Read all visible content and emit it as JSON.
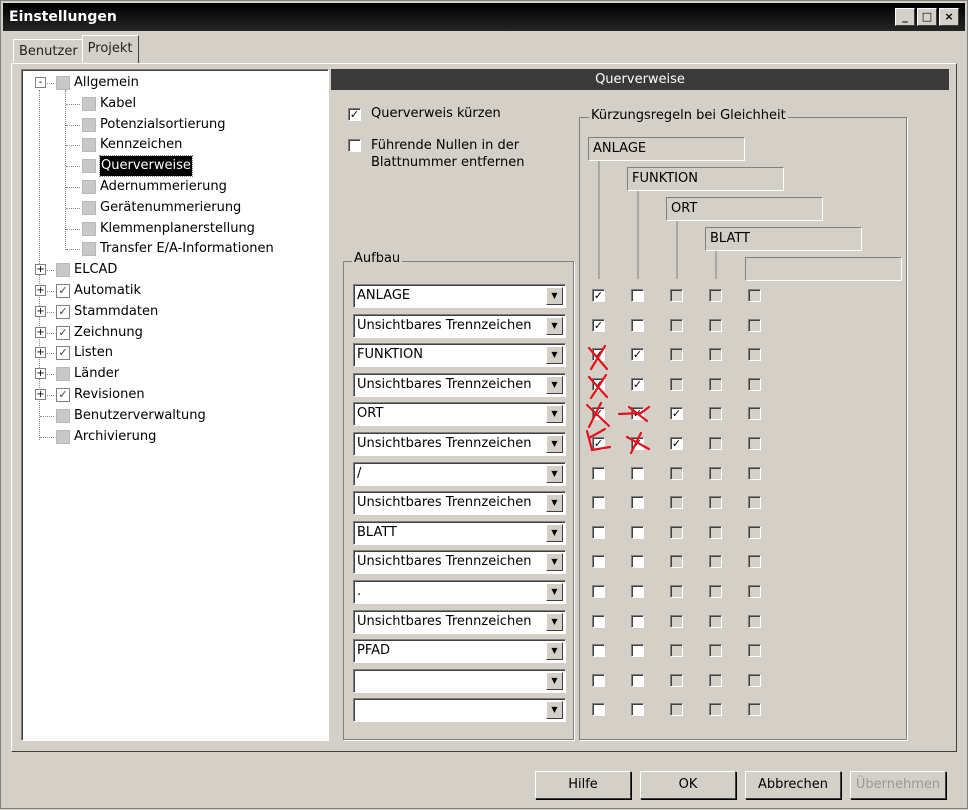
{
  "window": {
    "title": "Einstellungen",
    "min": "_",
    "max": "□",
    "close": "×"
  },
  "tabs": [
    {
      "label": "Benutzer"
    },
    {
      "label": "Projekt"
    }
  ],
  "tree": {
    "items": [
      {
        "label": "Allgemein"
      },
      {
        "label": "Kabel"
      },
      {
        "label": "Potenzialsortierung"
      },
      {
        "label": "Kennzeichen"
      },
      {
        "label": "Querverweise"
      },
      {
        "label": "Adernummerierung"
      },
      {
        "label": "Gerätenummerierung"
      },
      {
        "label": "Klemmenplanerstellung"
      },
      {
        "label": "Transfer E/A-Informationen"
      },
      {
        "label": "ELCAD"
      },
      {
        "label": "Automatik"
      },
      {
        "label": "Stammdaten"
      },
      {
        "label": "Zeichnung"
      },
      {
        "label": "Listen"
      },
      {
        "label": "Länder"
      },
      {
        "label": "Revisionen"
      },
      {
        "label": "Benutzerverwaltung"
      },
      {
        "label": "Archivierung"
      }
    ]
  },
  "panel": {
    "header": "Querverweise",
    "opt1": {
      "label": "Querverweis kürzen",
      "checked": true
    },
    "opt2": {
      "line1": "Führende Nullen in der",
      "line2": "Blattnummer entfernen",
      "checked": false
    },
    "aufbau": {
      "title": "Aufbau",
      "rows": [
        {
          "value": "ANLAGE",
          "checks": [
            true,
            false,
            false,
            false,
            false
          ]
        },
        {
          "value": "Unsichtbares Trennzeichen",
          "checks": [
            true,
            false,
            false,
            false,
            false
          ]
        },
        {
          "value": "FUNKTION",
          "checks": [
            true,
            true,
            false,
            false,
            false
          ]
        },
        {
          "value": "Unsichtbares Trennzeichen",
          "checks": [
            true,
            true,
            false,
            false,
            false
          ]
        },
        {
          "value": "ORT",
          "checks": [
            true,
            true,
            true,
            false,
            false
          ]
        },
        {
          "value": "Unsichtbares Trennzeichen",
          "checks": [
            true,
            true,
            true,
            false,
            false
          ]
        },
        {
          "value": "/",
          "checks": [
            false,
            false,
            false,
            false,
            false
          ]
        },
        {
          "value": "Unsichtbares Trennzeichen",
          "checks": [
            false,
            false,
            false,
            false,
            false
          ]
        },
        {
          "value": "BLATT",
          "checks": [
            false,
            false,
            false,
            false,
            false
          ]
        },
        {
          "value": "Unsichtbares Trennzeichen",
          "checks": [
            false,
            false,
            false,
            false,
            false
          ]
        },
        {
          "value": ".",
          "checks": [
            false,
            false,
            false,
            false,
            false
          ]
        },
        {
          "value": "Unsichtbares Trennzeichen",
          "checks": [
            false,
            false,
            false,
            false,
            false
          ]
        },
        {
          "value": "PFAD",
          "checks": [
            false,
            false,
            false,
            false,
            false
          ]
        },
        {
          "value": "",
          "checks": [
            false,
            false,
            false,
            false,
            false
          ]
        },
        {
          "value": "",
          "checks": [
            false,
            false,
            false,
            false,
            false
          ]
        }
      ]
    },
    "rules": {
      "title": "Kürzungsregeln bei Gleichheit",
      "labels": [
        "ANLAGE",
        "FUNKTION",
        "ORT",
        "BLATT",
        ""
      ]
    }
  },
  "buttons": {
    "help": "Hilfe",
    "ok": "OK",
    "cancel": "Abbrechen",
    "apply": "Übernehmen"
  },
  "annotation_color": "#e8101a"
}
